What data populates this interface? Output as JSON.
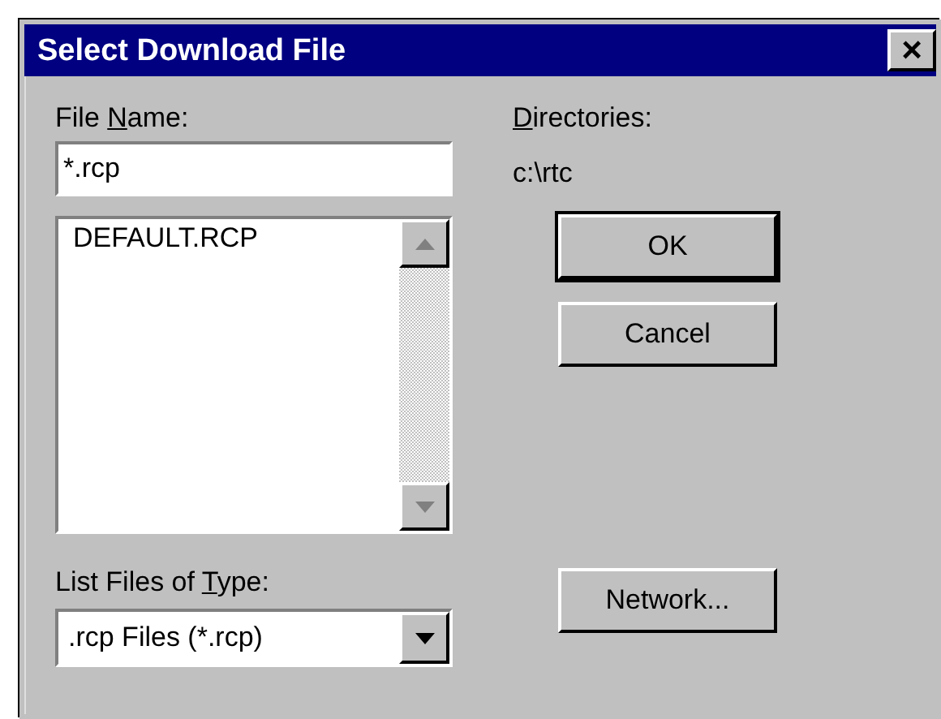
{
  "window": {
    "title": "Select Download File",
    "close": "×"
  },
  "file_name": {
    "label": {
      "before": "File ",
      "key": "N",
      "after": "ame:"
    },
    "value": "*.rcp"
  },
  "file_list": {
    "items": [
      {
        "name": "DEFAULT.RCP",
        "selected": false
      }
    ]
  },
  "file_type": {
    "label": {
      "before": "List Files of ",
      "key": "T",
      "after": "ype:"
    },
    "value": ".rcp Files (*.rcp)"
  },
  "directories": {
    "label": {
      "key": "D",
      "after": "irectories:"
    },
    "path": "c:\\rtc"
  },
  "buttons": [
    {
      "label": "OK",
      "default": true
    },
    {
      "label": "Cancel",
      "default": false
    },
    {
      "label": "Network...",
      "default": false
    }
  ]
}
